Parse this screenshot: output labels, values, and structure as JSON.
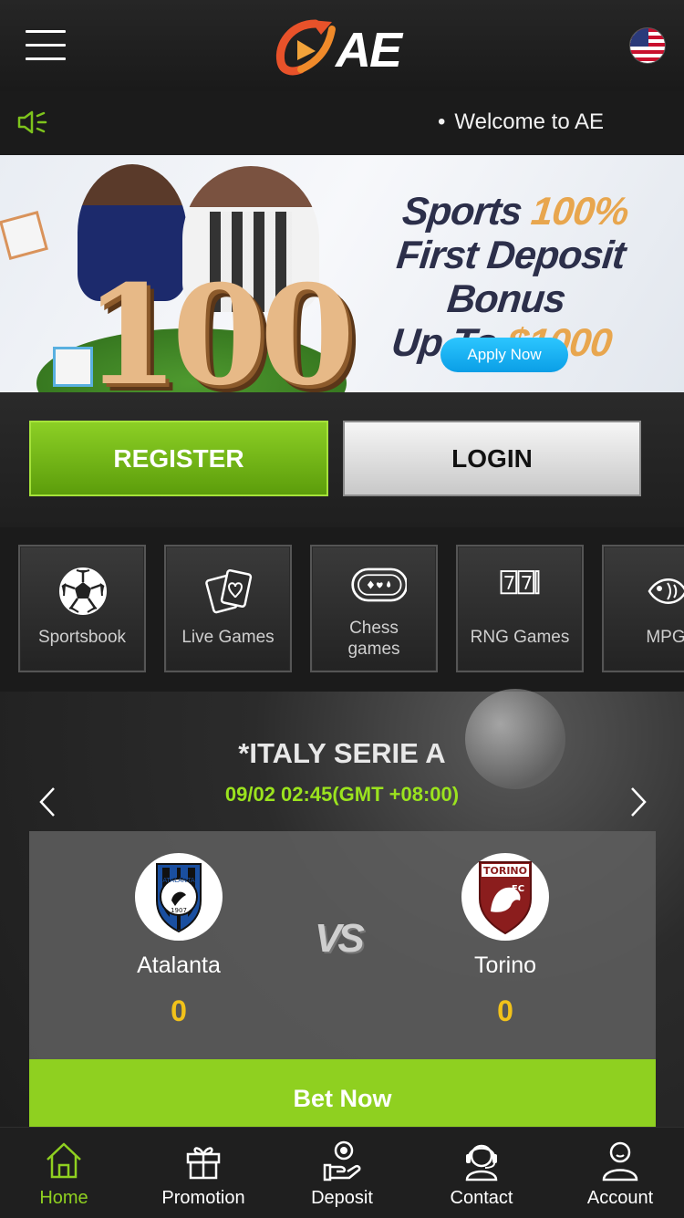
{
  "header": {
    "logo_text": "AE",
    "menu_icon": "hamburger-menu-icon",
    "flag_icon": "us-flag-icon"
  },
  "notice": {
    "icon": "speaker-icon",
    "text": "Welcome to AE"
  },
  "banner": {
    "line1_a": "Sports",
    "line1_b": "100%",
    "line2": "First Deposit Bonus",
    "line3_a": "Up To",
    "line3_b": "$1000",
    "big_number": "100",
    "apply_label": "Apply Now"
  },
  "auth": {
    "register_label": "REGISTER",
    "login_label": "LOGIN"
  },
  "categories": [
    {
      "label": "Sportsbook",
      "icon": "soccer-ball-icon"
    },
    {
      "label": "Live Games",
      "icon": "playing-cards-icon"
    },
    {
      "label": "Chess games",
      "line1": "Chess",
      "line2": "games",
      "icon": "chess-chip-icon"
    },
    {
      "label": "RNG Games",
      "icon": "slot-777-icon"
    },
    {
      "label": "MPG",
      "icon": "fish-icon"
    }
  ],
  "match": {
    "league": "*ITALY SERIE A",
    "time": "09/02 02:45(GMT +08:00)",
    "home": {
      "name": "Atalanta",
      "score": "0",
      "crest_text": "ATALANTA",
      "crest_year": "1907"
    },
    "away": {
      "name": "Torino",
      "score": "0",
      "crest_text": "TORINO",
      "crest_fc": "FC"
    },
    "vs": "VS",
    "bet_label": "Bet Now"
  },
  "nav": [
    {
      "label": "Home",
      "icon": "home-icon",
      "active": true
    },
    {
      "label": "Promotion",
      "icon": "gift-icon",
      "active": false
    },
    {
      "label": "Deposit",
      "icon": "deposit-hand-icon",
      "active": false
    },
    {
      "label": "Contact",
      "icon": "headset-icon",
      "active": false
    },
    {
      "label": "Account",
      "icon": "user-icon",
      "active": false
    }
  ],
  "colors": {
    "accent_green": "#8fd020",
    "score_gold": "#f2c21a",
    "time_green": "#9be31e",
    "apply_blue": "#0a9ee6"
  }
}
